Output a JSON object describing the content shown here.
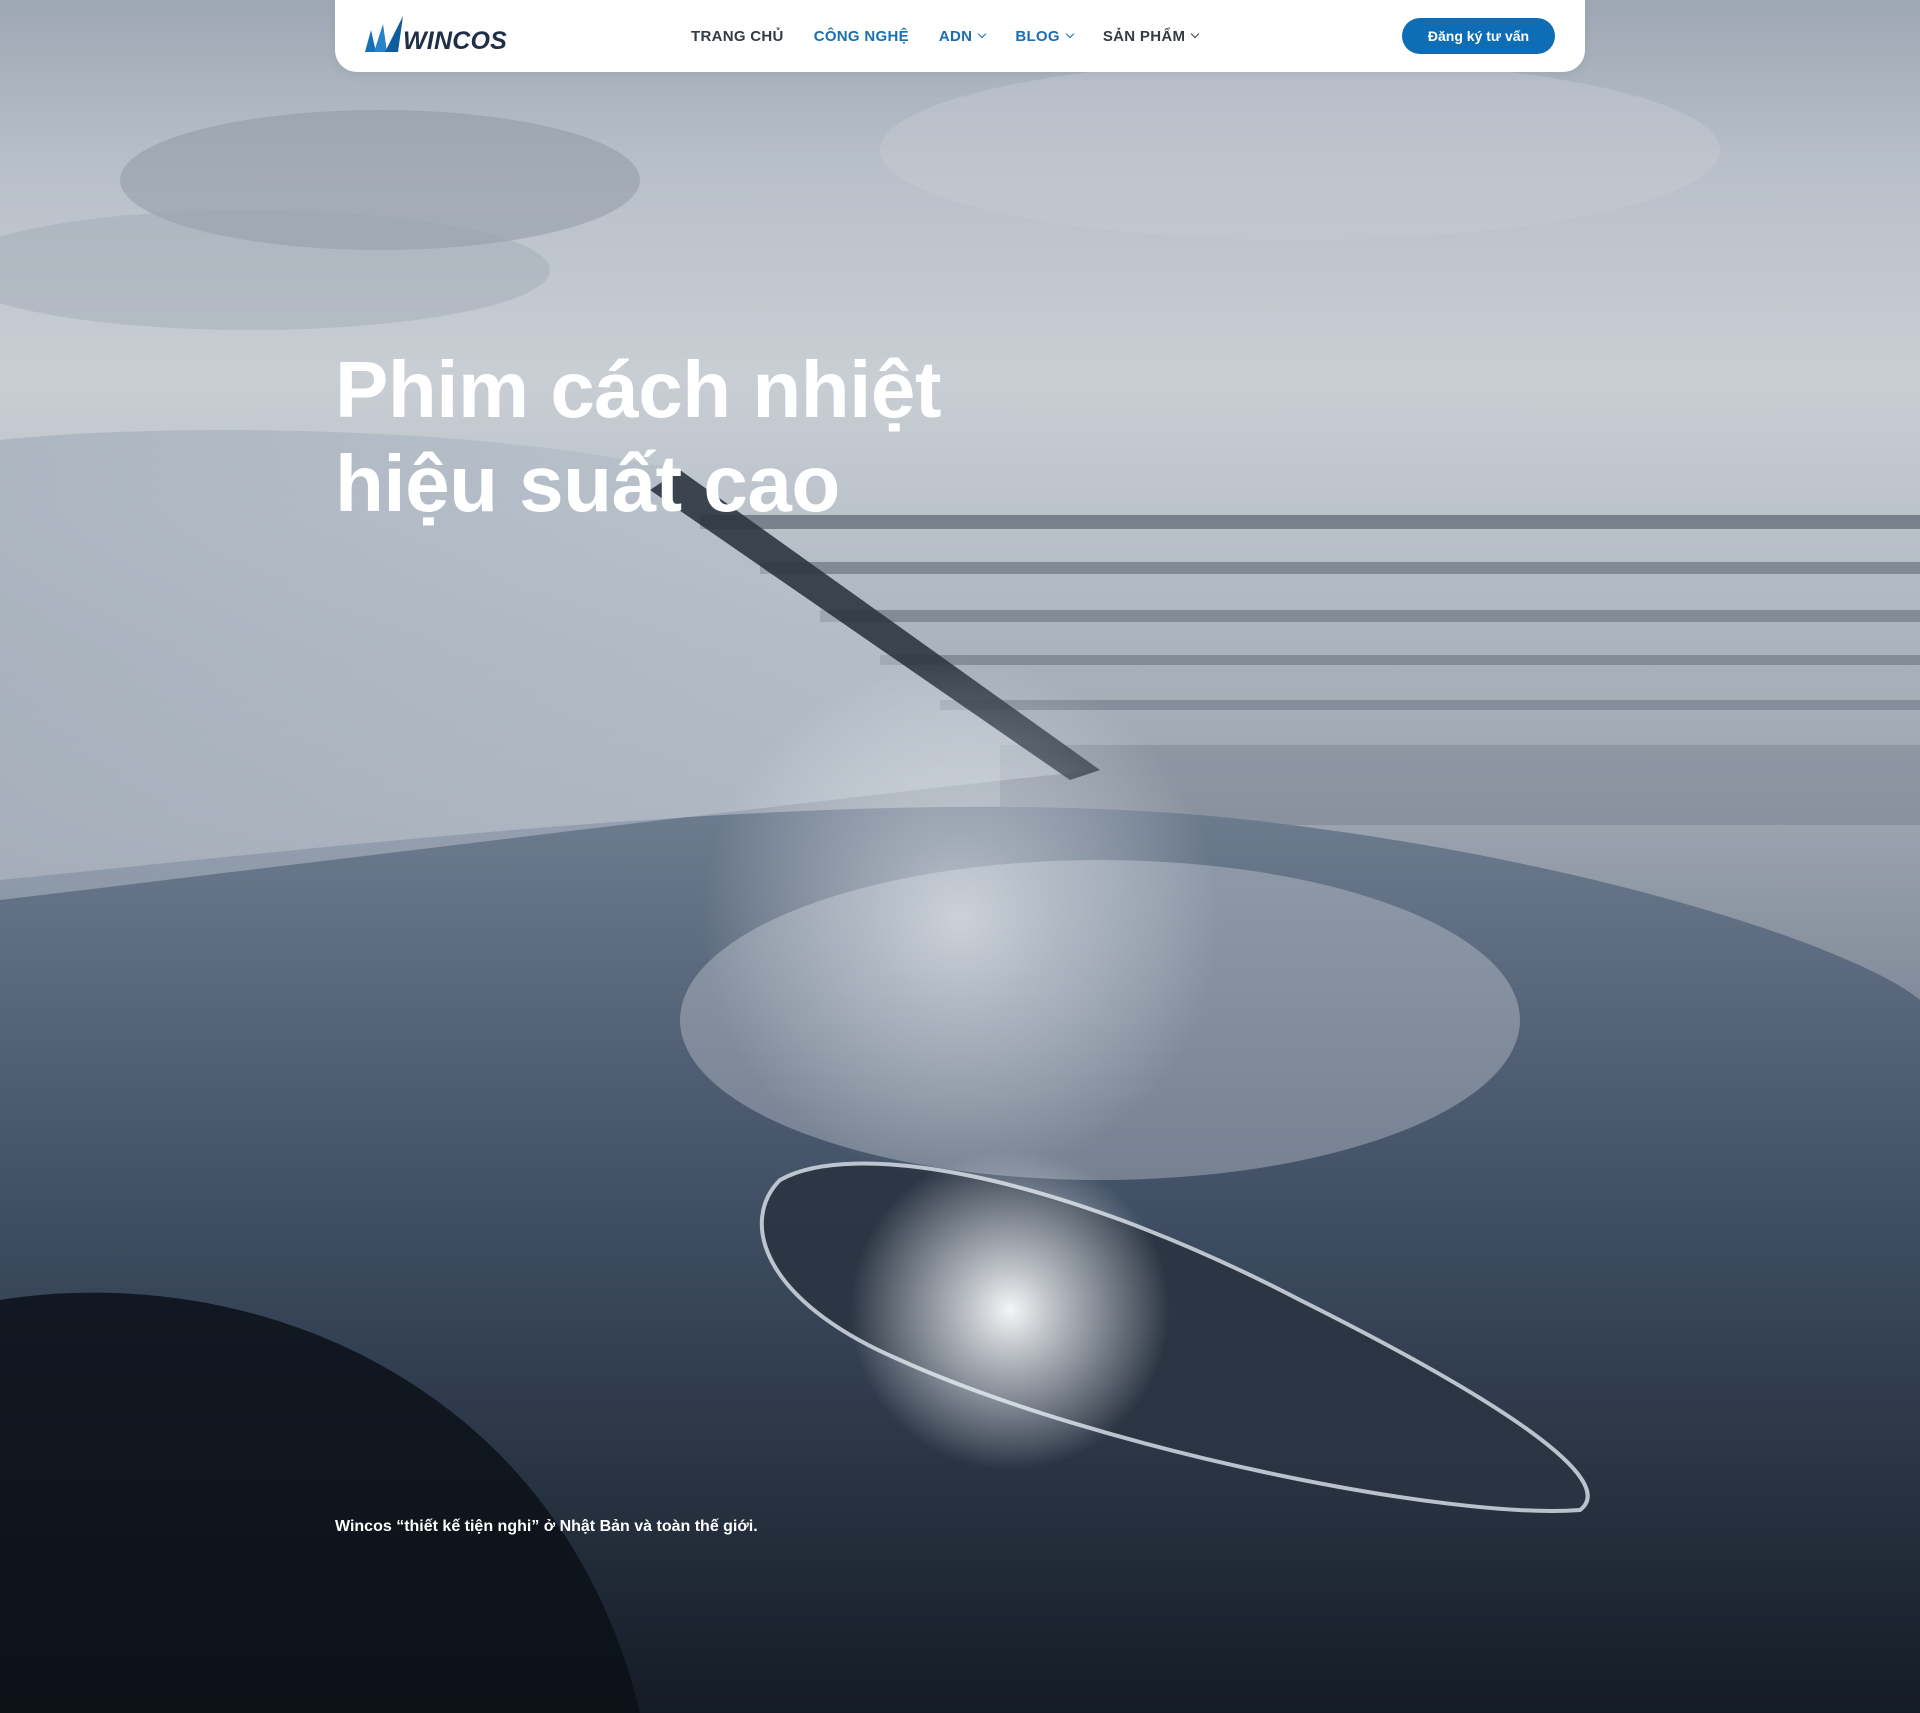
{
  "brand": {
    "name": "WINCOS",
    "logo_icon": "sail-logo-icon",
    "primary_color": "#0f6db5",
    "text_color": "#1f2f48"
  },
  "nav": {
    "items": [
      {
        "label": "TRANG CHỦ",
        "has_dropdown": false,
        "active": false
      },
      {
        "label": "CÔNG NGHỆ",
        "has_dropdown": false,
        "active": true
      },
      {
        "label": "ADN",
        "has_dropdown": true,
        "active": true
      },
      {
        "label": "BLOG",
        "has_dropdown": true,
        "active": true
      },
      {
        "label": "SẢN PHẨM",
        "has_dropdown": true,
        "active": false
      }
    ],
    "cta_label": "Đăng ký tư vấn"
  },
  "hero": {
    "headline_line1": "Phim cách nhiệt",
    "headline_line2": "hiệu suất cao",
    "tagline": "Wincos “thiết kế tiện nghi” ở Nhật Bản và toàn thế giới.",
    "background_image": "sports car on bridge"
  }
}
